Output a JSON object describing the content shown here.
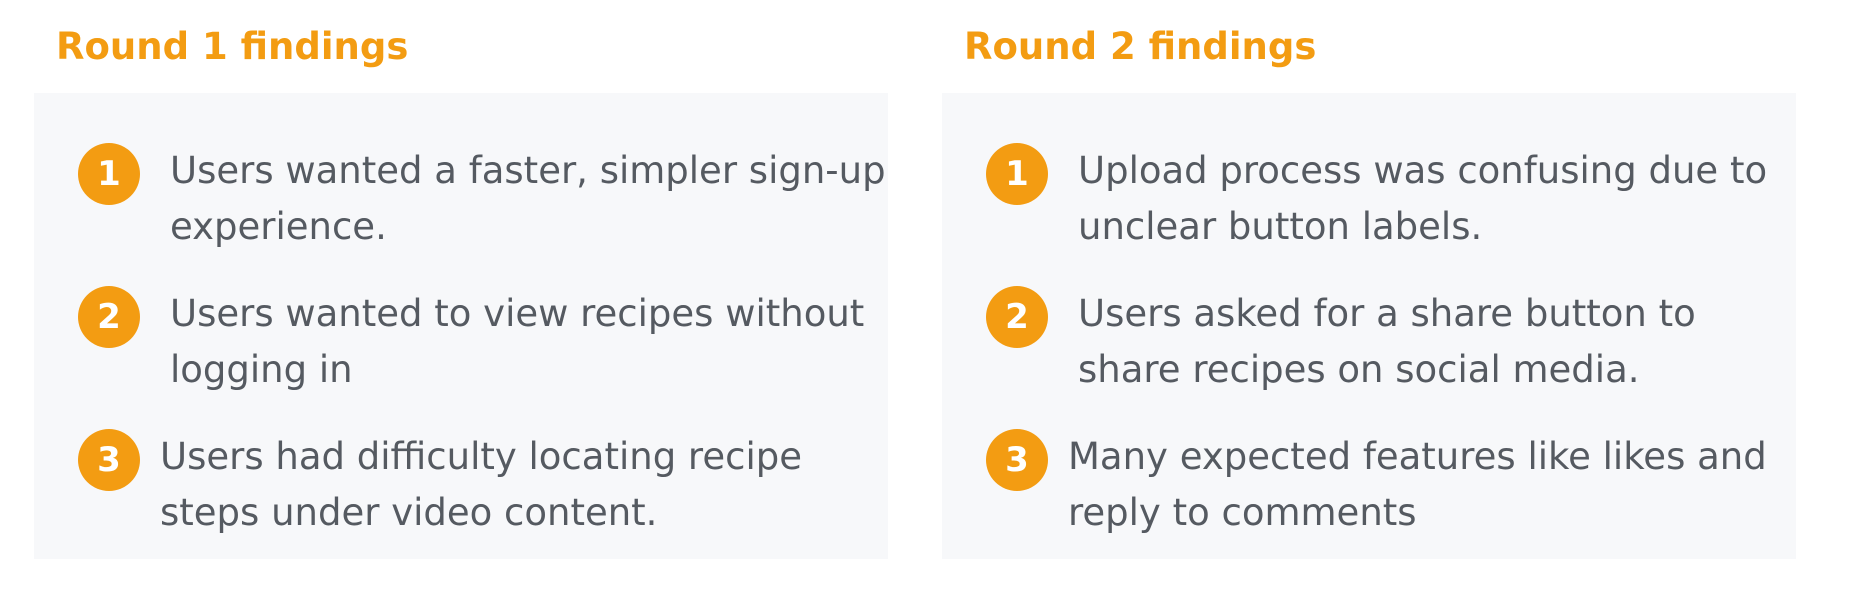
{
  "round_1": {
    "heading": "Round 1 findings",
    "items": [
      {
        "number": "1",
        "text": "Users wanted a faster, simpler sign-up experience."
      },
      {
        "number": "2",
        "text": "Users wanted to view recipes without logging in"
      },
      {
        "number": "3",
        "text": "Users had difficulty locating recipe steps under video content."
      }
    ]
  },
  "round_2": {
    "heading": "Round 2 findings",
    "items": [
      {
        "number": "1",
        "text": "Upload process was confusing due to unclear button labels."
      },
      {
        "number": "2",
        "text": "Users asked for a share button to share recipes on social media."
      },
      {
        "number": "3",
        "text": "Many expected features like likes and reply to comments"
      }
    ]
  },
  "colors": {
    "accent": "#f39c12",
    "panel_background": "#f7f8fa",
    "body_text": "#555a61",
    "badge_text": "#ffffff"
  }
}
